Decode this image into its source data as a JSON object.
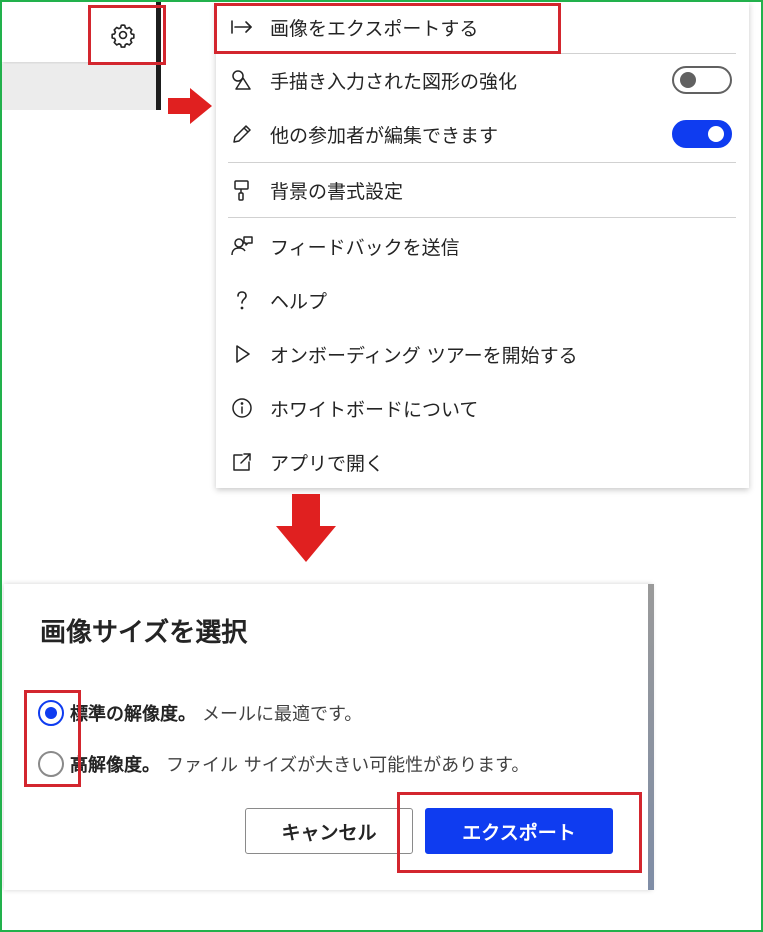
{
  "colors": {
    "highlight": "#d3262e",
    "accent": "#0f3cf0",
    "frame": "#22b14c"
  },
  "app": {
    "settings_icon": "gear-icon"
  },
  "menu": {
    "items": [
      {
        "icon": "export-arrow-icon",
        "label": "画像をエクスポートする"
      },
      {
        "icon": "shapes-icon",
        "label": "手描き入力された図形の強化",
        "toggle": "off"
      },
      {
        "icon": "pencil-icon",
        "label": "他の参加者が編集できます",
        "toggle": "on"
      },
      {
        "icon": "paint-roller-icon",
        "label": "背景の書式設定"
      },
      {
        "icon": "feedback-person-icon",
        "label": "フィードバックを送信"
      },
      {
        "icon": "question-icon",
        "label": "ヘルプ"
      },
      {
        "icon": "play-icon",
        "label": "オンボーディング ツアーを開始する"
      },
      {
        "icon": "info-icon",
        "label": "ホワイトボードについて"
      },
      {
        "icon": "open-external-icon",
        "label": "アプリで開く"
      }
    ]
  },
  "dialog": {
    "title": "画像サイズを選択",
    "options": [
      {
        "label": "標準の解像度。",
        "desc": "メールに最適です。",
        "checked": true
      },
      {
        "label": "高解像度。",
        "desc": "ファイル サイズが大きい可能性があります。",
        "checked": false
      }
    ],
    "cancel_label": "キャンセル",
    "export_label": "エクスポート"
  }
}
